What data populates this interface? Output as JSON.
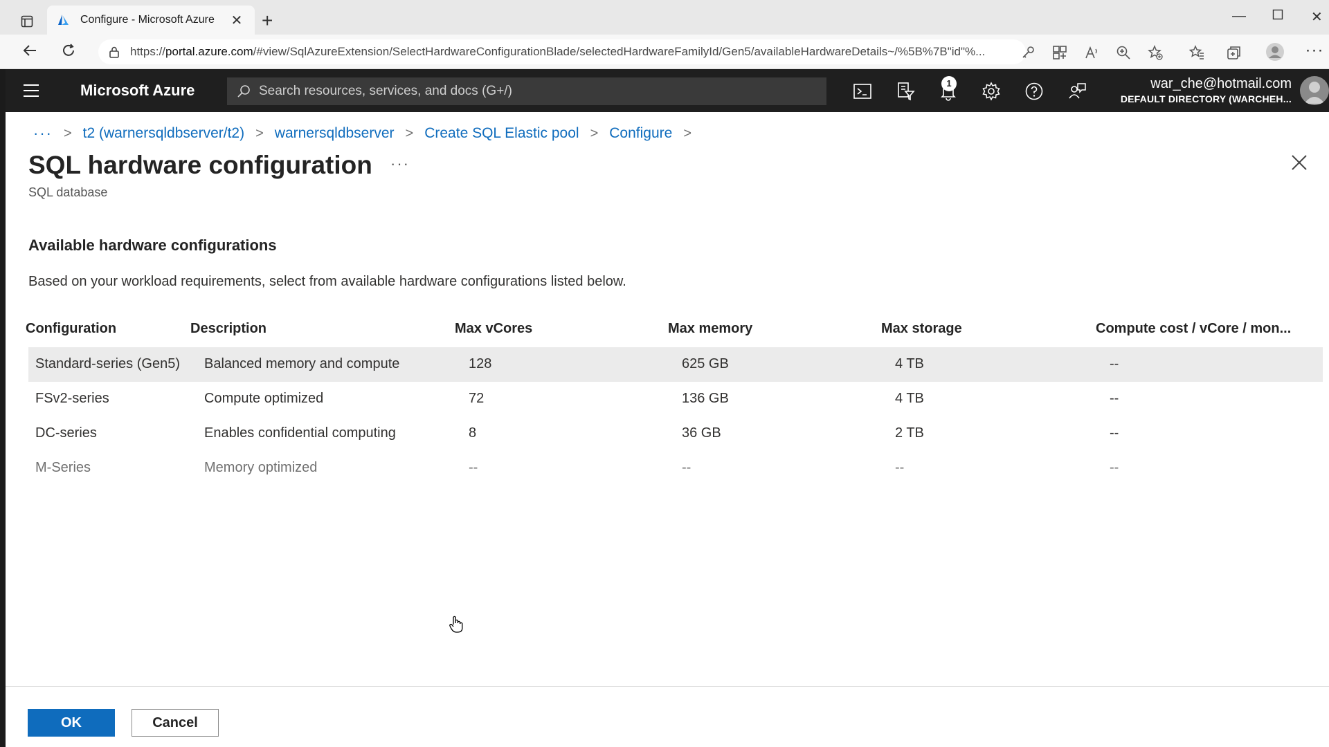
{
  "browser": {
    "tab_title": "Configure - Microsoft Azure",
    "url_prefix": "https://",
    "url_host": "portal.azure.com",
    "url_path": "/#view/SqlAzureExtension/SelectHardwareConfigurationBlade/selectedHardwareFamilyId/Gen5/availableHardwareDetails~/%5B%7B\"id\"%..."
  },
  "header": {
    "brand": "Microsoft Azure",
    "search_placeholder": "Search resources, services, and docs (G+/)",
    "notification_count": "1",
    "account_email": "war_che@hotmail.com",
    "account_directory": "DEFAULT DIRECTORY (WARCHEH..."
  },
  "breadcrumb": {
    "dots": "···",
    "items": [
      "t2 (warnersqldbserver/t2)",
      "warnersqldbserver",
      "Create SQL Elastic pool",
      "Configure"
    ]
  },
  "page": {
    "title": "SQL hardware configuration",
    "more": "···",
    "subtitle": "SQL database",
    "section_heading": "Available hardware configurations",
    "section_desc": "Based on your workload requirements, select from available hardware configurations listed below."
  },
  "table": {
    "columns": [
      "Configuration",
      "Description",
      "Max vCores",
      "Max memory",
      "Max storage",
      "Compute cost / vCore / mon..."
    ],
    "rows": [
      [
        "Standard-series (Gen5)",
        "Balanced memory and compute",
        "128",
        "625 GB",
        "4 TB",
        "--"
      ],
      [
        "FSv2-series",
        "Compute optimized",
        "72",
        "136 GB",
        "4 TB",
        "--"
      ],
      [
        "DC-series",
        "Enables confidential computing",
        "8",
        "36 GB",
        "2 TB",
        "--"
      ],
      [
        "M-Series",
        "Memory optimized",
        "--",
        "--",
        "--",
        "--"
      ]
    ]
  },
  "footer": {
    "ok_label": "OK",
    "cancel_label": "Cancel"
  },
  "colors": {
    "azure_blue": "#0f6cbd",
    "header_bg": "#1f1f1f"
  }
}
